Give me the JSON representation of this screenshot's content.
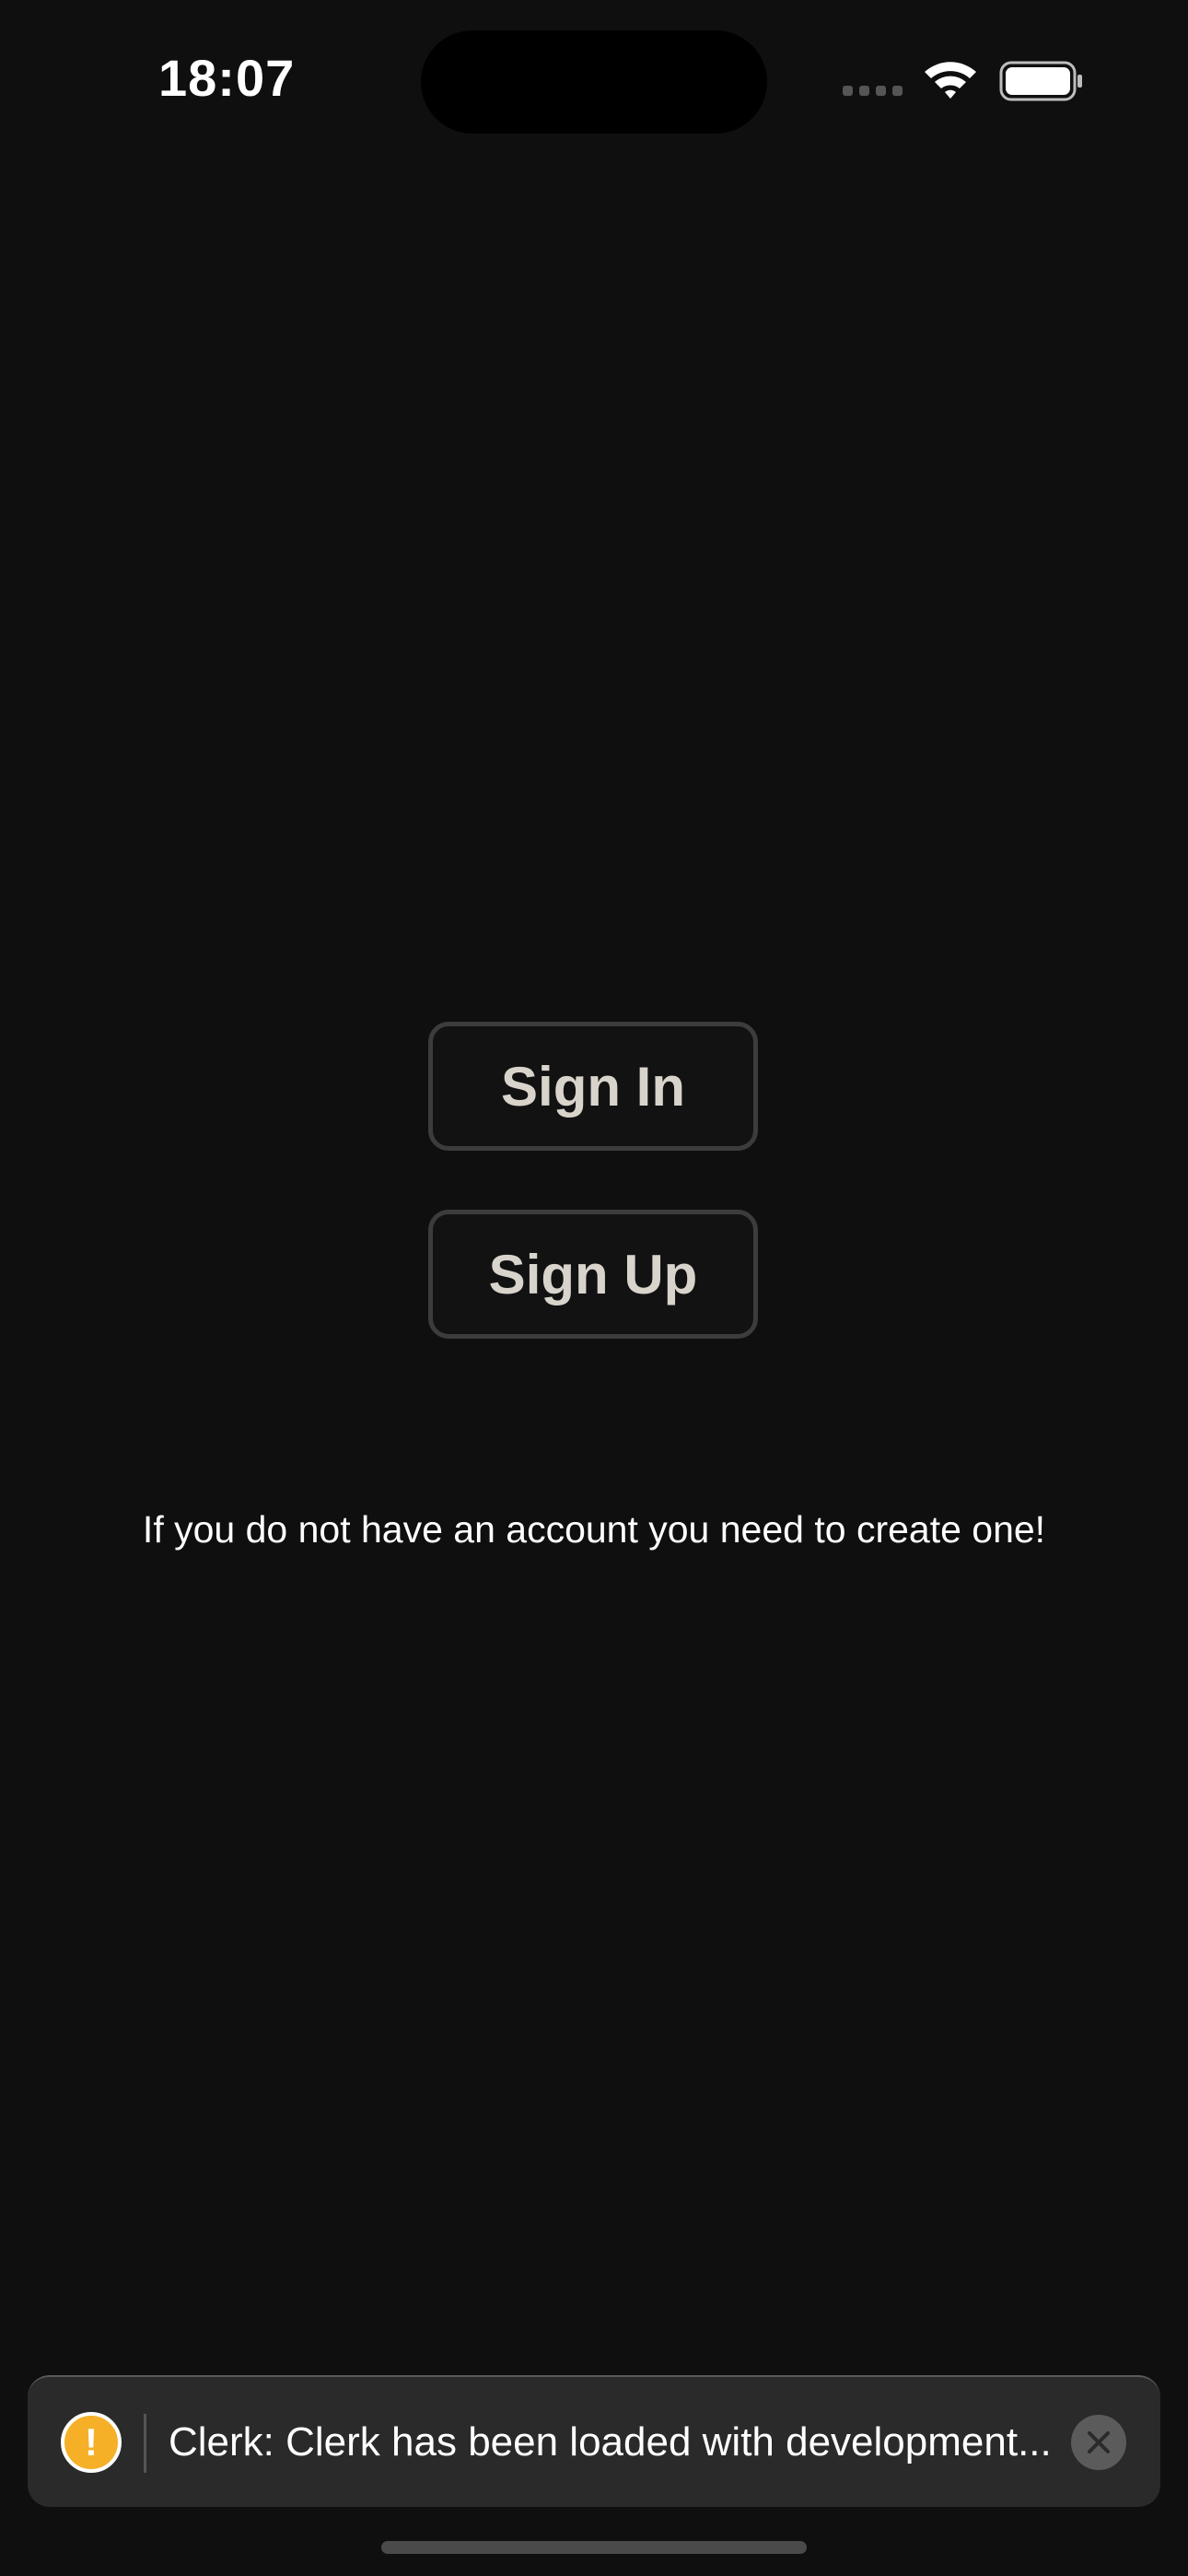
{
  "status_bar": {
    "time": "18:07",
    "icons": [
      "cellular-signal-icon",
      "wifi-icon",
      "battery-icon"
    ]
  },
  "auth": {
    "sign_in_label": "Sign In",
    "sign_up_label": "Sign Up",
    "info_text": "If you do not have an account you need to create one!"
  },
  "toast": {
    "icon": "warning-icon",
    "message": "Clerk: Clerk has been loaded with development...",
    "close_icon": "close-icon"
  },
  "colors": {
    "background": "#0f0f0f",
    "button_border": "#3c3c3c",
    "button_text": "#d8d4cc",
    "toast_background": "#2a2a2a",
    "warning": "#f5b027"
  }
}
